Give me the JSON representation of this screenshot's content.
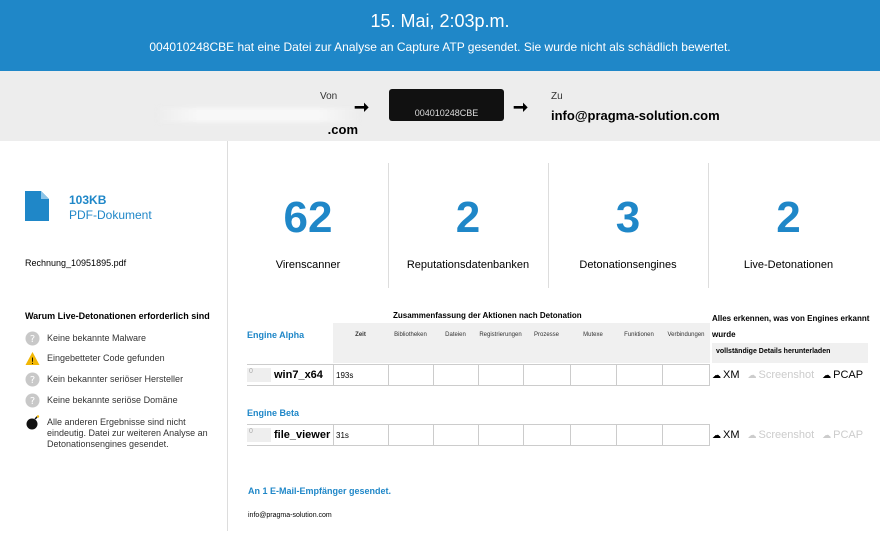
{
  "header": {
    "date": "15. Mai, 2:03p.m.",
    "message": "004010248CBE hat eine Datei zur Analyse an Capture ATP gesendet. Sie wurde nicht als schädlich bewertet."
  },
  "route": {
    "from_label": "Von",
    "from_value": ".com",
    "device": "004010248CBE",
    "to_label": "Zu",
    "to_value": "info@pragma-solution.com"
  },
  "file": {
    "size": "103KB",
    "type": "PDF-Dokument",
    "name": "Rechnung_10951895.pdf"
  },
  "why": {
    "title": "Warum Live-Detonationen erforderlich sind",
    "reasons": [
      {
        "icon": "question-icon",
        "text": "Keine bekannte Malware"
      },
      {
        "icon": "warning-icon",
        "text": "Eingebetteter Code gefunden"
      },
      {
        "icon": "question-icon",
        "text": "Kein bekannter seriöser Hersteller"
      },
      {
        "icon": "question-icon",
        "text": "Keine bekannte seriöse Domäne"
      },
      {
        "icon": "bomb-icon",
        "text": "Alle anderen Ergebnisse sind nicht eindeutig. Datei zur weiteren Analyse an Detonationsengines gesendet."
      }
    ]
  },
  "stats": [
    {
      "value": "62",
      "label": "Virenscanner"
    },
    {
      "value": "2",
      "label": "Reputationsdatenbanken"
    },
    {
      "value": "3",
      "label": "Detonationsengines"
    },
    {
      "value": "2",
      "label": "Live-Detonationen"
    }
  ],
  "summary": {
    "title": "Zusammenfassung der Aktionen nach Detonation",
    "detect_title": "Alles erkennen, was von Engines erkannt wurde",
    "download_label": "vollständige Details herunterladen",
    "columns": [
      "Zeit",
      "Bibliotheken",
      "Dateien",
      "Registrierungen",
      "Prozesse",
      "Mutexe",
      "Funktionen",
      "Verbindungen"
    ]
  },
  "engines": [
    {
      "title": "Engine Alpha",
      "count": "0",
      "name": "win7_x64",
      "time": "193s",
      "links": [
        {
          "label": "XM",
          "enabled": true
        },
        {
          "label": "Screenshot",
          "enabled": false
        },
        {
          "label": "PCAP",
          "enabled": true
        }
      ]
    },
    {
      "title": "Engine Beta",
      "count": "0",
      "name": "file_viewer",
      "time": "31s",
      "links": [
        {
          "label": "XM",
          "enabled": true
        },
        {
          "label": "Screenshot",
          "enabled": false
        },
        {
          "label": "PCAP",
          "enabled": false
        }
      ]
    }
  ],
  "sent": {
    "title": "An 1 E-Mail-Empfänger gesendet.",
    "address": "info@pragma-solution.com"
  },
  "colors": {
    "accent": "#1f87c8",
    "warning": "#f2b705",
    "gray_bg": "#ededed"
  }
}
